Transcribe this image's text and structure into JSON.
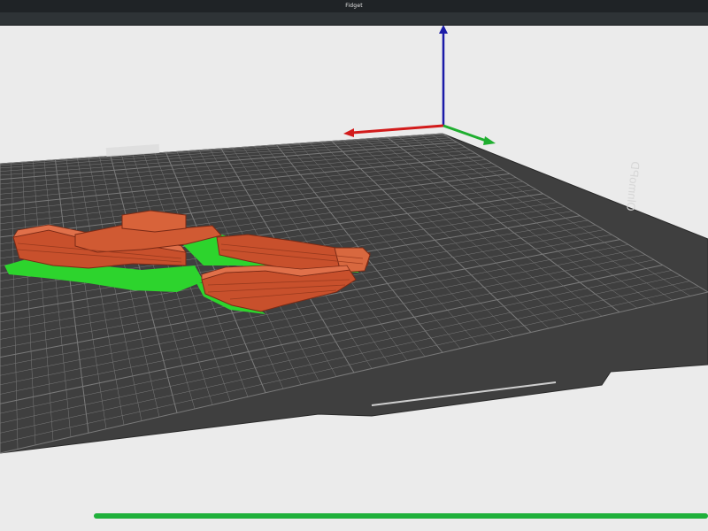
{
  "window": {
    "title": "Fidget"
  },
  "bed": {
    "label": "OlnmoPD"
  },
  "progress": {
    "fraction": 1.0
  },
  "colors": {
    "background": "#ebebeb",
    "bed": "#3f3f3f",
    "grid": "#7a7a7a",
    "axis_x": "#d21b1b",
    "axis_y": "#1fae2f",
    "axis_z": "#1b1ba8",
    "model": "#c8502c",
    "support": "#2dd42d",
    "progress": "#1fb03a"
  }
}
